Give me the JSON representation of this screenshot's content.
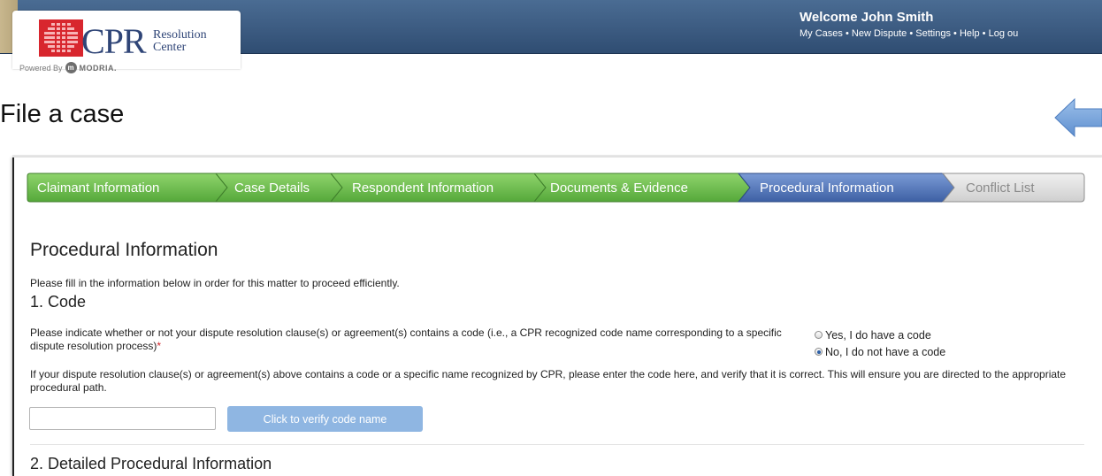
{
  "header": {
    "logo": {
      "cpr": "CPR",
      "resolution": "Resolution",
      "center": "Center"
    },
    "powered_by": "Powered By",
    "modria": "MODRIA.",
    "welcome": "Welcome John Smith",
    "links": [
      "My Cases",
      "New Dispute",
      "Settings",
      "Help",
      "Log ou"
    ],
    "separator": "•"
  },
  "page_title": "File a case",
  "steps": [
    {
      "label": "Claimant Information",
      "state": "complete"
    },
    {
      "label": "Case Details",
      "state": "complete"
    },
    {
      "label": "Respondent Information",
      "state": "complete"
    },
    {
      "label": "Documents & Evidence",
      "state": "complete"
    },
    {
      "label": "Procedural Information",
      "state": "active"
    },
    {
      "label": "Conflict List",
      "state": "pending"
    }
  ],
  "colors": {
    "step_complete": "#6cbd4a",
    "step_active": "#4f74b6",
    "step_pending": "#d8d8d8",
    "header": "#3c5b81",
    "button": "#8fb6e2"
  },
  "section": {
    "title": "Procedural Information",
    "intro": "Please fill in the information below in order for this matter to proceed efficiently.",
    "code_heading": "1. Code",
    "code_question": "Please indicate whether or not your dispute resolution clause(s) or agreement(s) contains a code (i.e., a CPR recognized code name corresponding to a specific dispute resolution process)",
    "required_mark": "*",
    "radio_yes": "Yes, I do have a code",
    "radio_no": "No, I do not have a code",
    "selected": "no",
    "verify_text": "If your dispute resolution clause(s) or agreement(s) above contains a code or a specific name recognized by CPR, please enter the code here, and verify that it is correct. This will ensure you are directed to the appropriate procedural path.",
    "code_input_value": "",
    "verify_button": "Click to verify code name",
    "detailed_heading": "2. Detailed Procedural Information"
  }
}
